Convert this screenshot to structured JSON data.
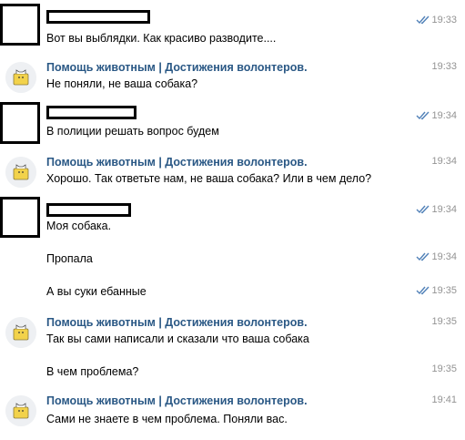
{
  "community_name": "Помощь животным | Достижения волонтеров.",
  "icons": {
    "read_status": "double-check-icon",
    "community_avatar": "dog-logo-icon"
  },
  "colors": {
    "sender": "#2a5885",
    "time": "#939393",
    "check": "#5181b8"
  },
  "messages": [
    {
      "author": "redacted",
      "text": "Вот вы выблядки. Как красиво разводите....",
      "time": "19:33",
      "read": true
    },
    {
      "author": "community",
      "text": "Не поняли, не ваша собака?",
      "time": "19:33"
    },
    {
      "author": "redacted",
      "text": "В полиции решать вопрос будем",
      "time": "19:34",
      "read": true
    },
    {
      "author": "community",
      "text": "Хорошо. Так ответьте нам, не ваша собака? Или в чем дело?",
      "time": "19:34"
    },
    {
      "author": "redacted",
      "text": "Моя собака.",
      "time": "19:34",
      "read": true
    },
    {
      "author": "redacted",
      "text": "Пропала",
      "time": "19:34",
      "read": true
    },
    {
      "author": "redacted",
      "text": "А вы суки ебанные",
      "time": "19:35",
      "read": true
    },
    {
      "author": "community",
      "text": "Так вы сами написали и сказали что ваша собака",
      "time": "19:35"
    },
    {
      "author": "community",
      "text": "В чем проблема?",
      "time": "19:35"
    },
    {
      "author": "community",
      "text": "Сами не знаете в чем проблема. Поняли вас.",
      "time": "19:41"
    }
  ]
}
